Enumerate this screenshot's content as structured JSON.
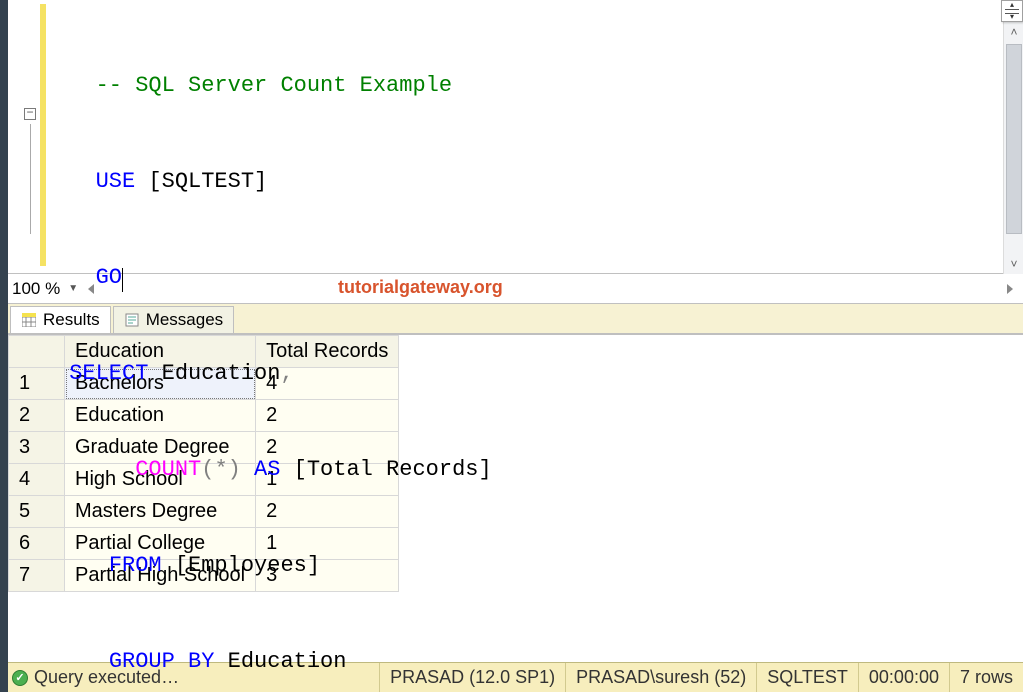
{
  "code": {
    "comment": "-- SQL Server Count Example",
    "use_kw": "USE",
    "use_db": " [SQLTEST]",
    "go_kw": "GO",
    "select_kw": "SELECT",
    "select_col": " Education",
    "count_fn": "COUNT",
    "count_args_open": "(",
    "count_star": "*",
    "count_args_close": ")",
    "as_kw": " AS",
    "as_alias": " [Total Records]",
    "from_kw": "FROM",
    "from_tbl": " [Employees]",
    "groupby_kw": "GROUP BY",
    "groupby_col": " Education",
    "comma": ","
  },
  "zoom": "100 %",
  "watermark": "tutorialgateway.org",
  "tabs": {
    "results": "Results",
    "messages": "Messages"
  },
  "grid": {
    "headers": [
      "Education",
      "Total Records"
    ],
    "rows": [
      {
        "n": "1",
        "c0": "Bachelors",
        "c1": "4"
      },
      {
        "n": "2",
        "c0": "Education",
        "c1": "2"
      },
      {
        "n": "3",
        "c0": "Graduate Degree",
        "c1": "2"
      },
      {
        "n": "4",
        "c0": "High School",
        "c1": "1"
      },
      {
        "n": "5",
        "c0": "Masters Degree",
        "c1": "2"
      },
      {
        "n": "6",
        "c0": "Partial College",
        "c1": "1"
      },
      {
        "n": "7",
        "c0": "Partial High School",
        "c1": "3"
      }
    ]
  },
  "status": {
    "msg": "Query executed…",
    "server": "PRASAD (12.0 SP1)",
    "user": "PRASAD\\suresh (52)",
    "db": "SQLTEST",
    "time": "00:00:00",
    "rows": "7 rows"
  }
}
